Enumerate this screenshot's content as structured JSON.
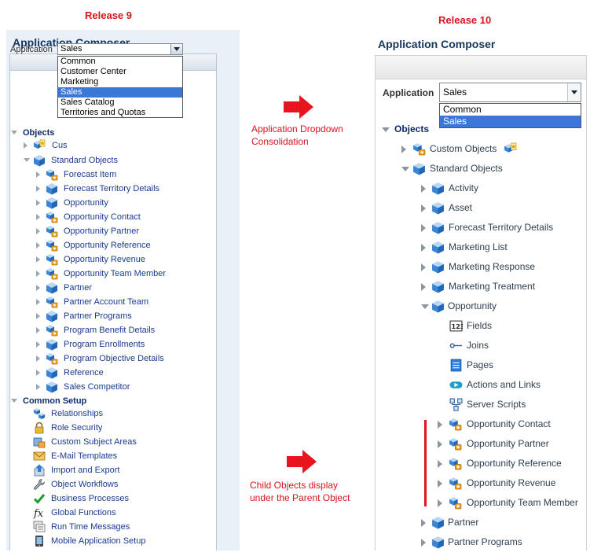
{
  "labels": {
    "release9": "Release 9",
    "release10": "Release 10"
  },
  "annotations": {
    "dropdown": [
      "Application Dropdown",
      "Consolidation"
    ],
    "child": [
      "Child Objects display",
      "under the Parent Object"
    ]
  },
  "r9": {
    "title": "Application Composer",
    "application_label": "Application",
    "selected": "Sales",
    "options": [
      "Common",
      "Customer Center",
      "Marketing",
      "Sales",
      "Sales Catalog",
      "Territories and Quotas"
    ],
    "selected_index": 3,
    "objects_label": "Objects",
    "custom_objects_partial": "Cus",
    "standard_objects": "Standard Objects",
    "objects": [
      "Forecast Item",
      "Forecast Territory Details",
      "Opportunity",
      "Opportunity Contact",
      "Opportunity Partner",
      "Opportunity Reference",
      "Opportunity Revenue",
      "Opportunity Team Member",
      "Partner",
      "Partner Account Team",
      "Partner Programs",
      "Program Benefit Details",
      "Program Enrollments",
      "Program Objective Details",
      "Reference",
      "Sales Competitor"
    ],
    "common_setup_label": "Common Setup",
    "common_setup": [
      {
        "label": "Relationships",
        "icon": "relationships-icon"
      },
      {
        "label": "Role Security",
        "icon": "lock-icon"
      },
      {
        "label": "Custom Subject Areas",
        "icon": "subject-areas-icon"
      },
      {
        "label": "E-Mail Templates",
        "icon": "envelope-icon"
      },
      {
        "label": "Import and Export",
        "icon": "import-export-icon"
      },
      {
        "label": "Object Workflows",
        "icon": "wrench-icon"
      },
      {
        "label": "Business Processes",
        "icon": "checkmark-icon"
      },
      {
        "label": "Global Functions",
        "icon": "function-icon"
      },
      {
        "label": "Run Time Messages",
        "icon": "messages-icon"
      },
      {
        "label": "Mobile Application Setup",
        "icon": "mobile-icon"
      }
    ]
  },
  "r10": {
    "title": "Application Composer",
    "application_label": "Application",
    "selected": "Sales",
    "options": [
      "Common",
      "Sales"
    ],
    "selected_index": 1,
    "objects_label": "Objects",
    "custom_objects": "Custom Objects",
    "standard_objects": "Standard Objects",
    "objects_before": [
      "Activity",
      "Asset",
      "Forecast Territory Details",
      "Marketing List",
      "Marketing Response",
      "Marketing Treatment"
    ],
    "opportunity": "Opportunity",
    "opportunity_children": [
      {
        "label": "Fields",
        "icon": "fields-icon"
      },
      {
        "label": "Joins",
        "icon": "joins-icon"
      },
      {
        "label": "Pages",
        "icon": "pages-icon"
      },
      {
        "label": "Actions and Links",
        "icon": "actions-icon"
      },
      {
        "label": "Server Scripts",
        "icon": "scripts-icon"
      }
    ],
    "child_objects": [
      "Opportunity Contact",
      "Opportunity Partner",
      "Opportunity Reference",
      "Opportunity Revenue",
      "Opportunity Team Member"
    ],
    "objects_after": [
      "Partner",
      "Partner Programs"
    ]
  }
}
